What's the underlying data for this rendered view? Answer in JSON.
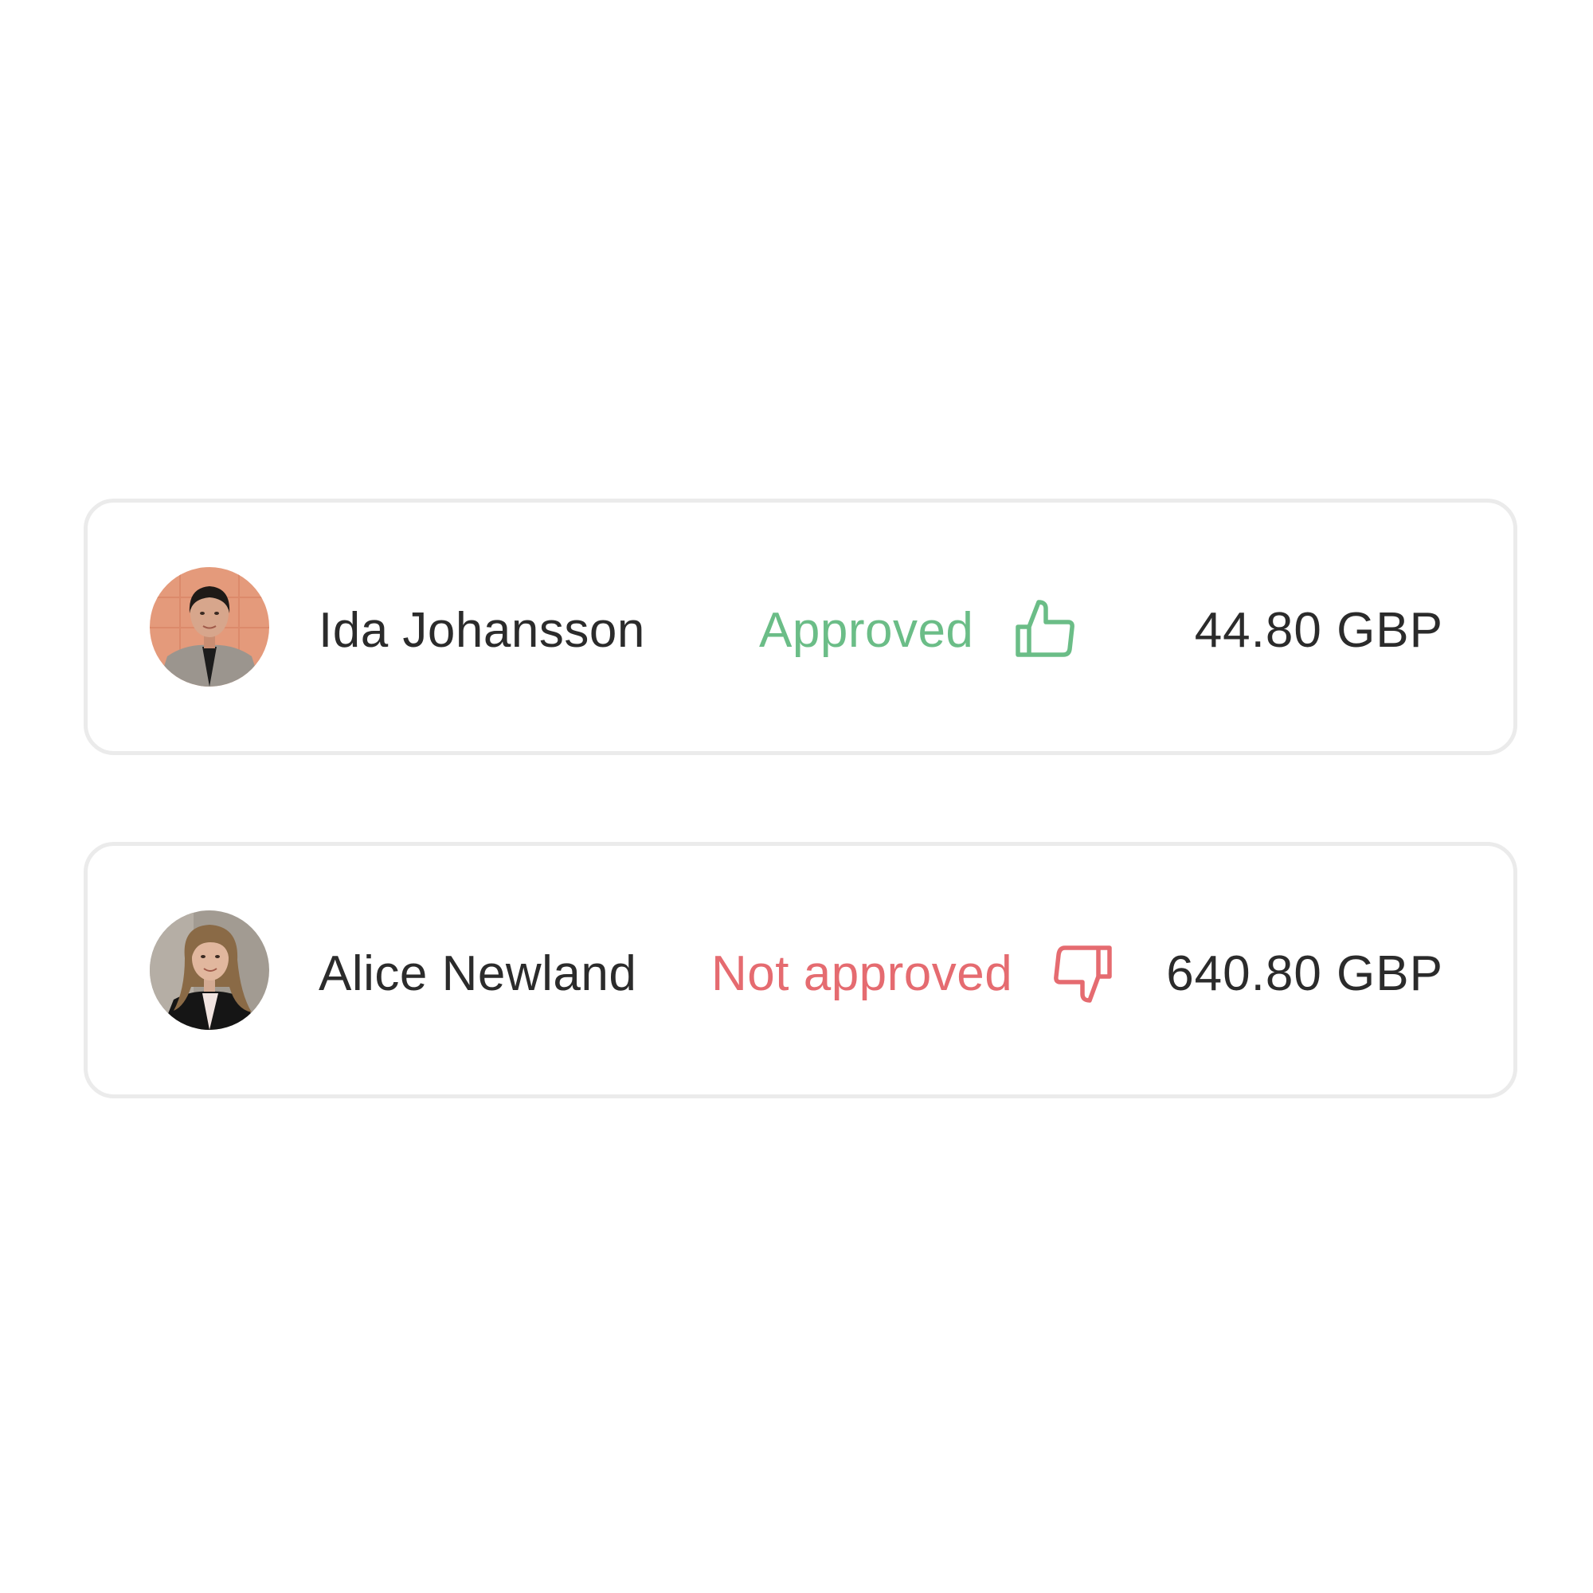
{
  "rows": [
    {
      "name": "Ida Johansson",
      "status": "Approved",
      "status_icon": "thumbs-up-icon",
      "status_color": "#6bbd87",
      "amount": "44.80 GBP"
    },
    {
      "name": "Alice Newland",
      "status": "Not approved",
      "status_icon": "thumbs-down-icon",
      "status_color": "#e56b70",
      "amount": "640.80 GBP"
    }
  ],
  "colors": {
    "text": "#2b2b2b",
    "card_border": "#ebebeb",
    "background": "#ffffff"
  }
}
